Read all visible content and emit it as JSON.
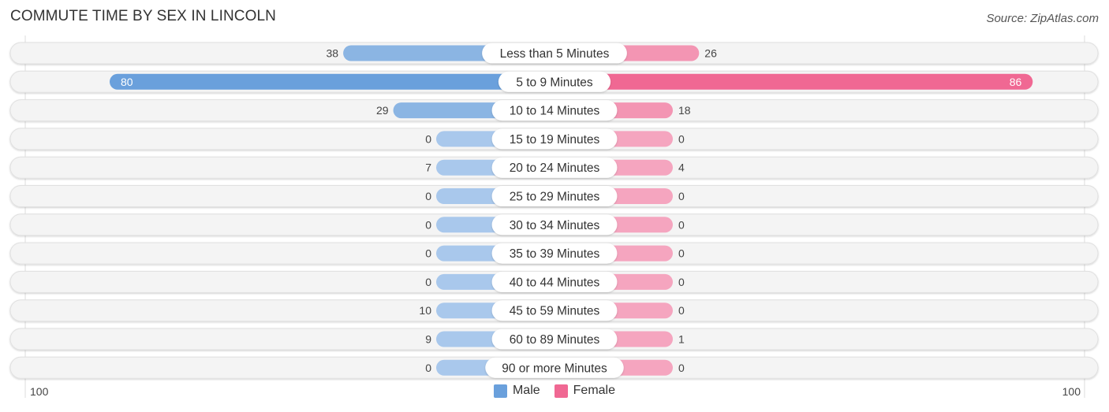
{
  "title": "COMMUTE TIME BY SEX IN LINCOLN",
  "source": "Source: ZipAtlas.com",
  "legend": [
    {
      "name": "Male",
      "color": "#6aa0dc"
    },
    {
      "name": "Female",
      "color": "#f06893"
    }
  ],
  "axis": {
    "left_label": "100",
    "right_label": "100"
  },
  "chart_data": {
    "type": "bar",
    "orientation": "horizontal-diverging",
    "title": "COMMUTE TIME BY SEX IN LINCOLN",
    "categories": [
      "Less than 5 Minutes",
      "5 to 9 Minutes",
      "10 to 14 Minutes",
      "15 to 19 Minutes",
      "20 to 24 Minutes",
      "25 to 29 Minutes",
      "30 to 34 Minutes",
      "35 to 39 Minutes",
      "40 to 44 Minutes",
      "45 to 59 Minutes",
      "60 to 89 Minutes",
      "90 or more Minutes"
    ],
    "series": [
      {
        "name": "Male",
        "color": "#6aa0dc",
        "light_color": "#a9c8ec",
        "values": [
          38,
          80,
          29,
          0,
          7,
          0,
          0,
          0,
          0,
          10,
          9,
          0
        ]
      },
      {
        "name": "Female",
        "color": "#f06893",
        "light_color": "#f5a5bf",
        "values": [
          26,
          86,
          18,
          0,
          4,
          0,
          0,
          0,
          0,
          0,
          1,
          0
        ]
      }
    ],
    "xlim": [
      100,
      100
    ],
    "xlabel_left": "100",
    "xlabel_right": "100",
    "legend_position": "bottom-center",
    "grid": false
  }
}
